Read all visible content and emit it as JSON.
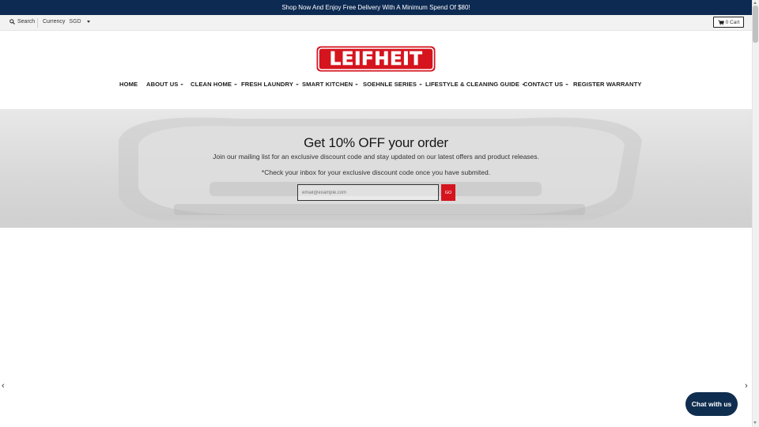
{
  "announcement": "Shop Now And Enjoy Free Delivery With A Minimum Spend Of $80!",
  "topbar": {
    "search_label": "Search",
    "currency_label": "Currency",
    "currency_value": "SGD",
    "cart_label": "0 Cart"
  },
  "logo": {
    "text": "LEIFHEIT"
  },
  "nav": {
    "items": [
      {
        "label": "HOME"
      },
      {
        "label": "ABOUT US"
      },
      {
        "label": "CLEAN HOME"
      },
      {
        "label": "FRESH LAUNDRY"
      },
      {
        "label": "SMART KITCHEN"
      },
      {
        "label": "SOEHNLE SERIES"
      },
      {
        "label": "LIFESTYLE & CLEANING GUIDE"
      },
      {
        "label": "CONTACT US"
      },
      {
        "label": "REGISTER WARRANTY"
      }
    ]
  },
  "promo": {
    "title": "Get 10% OFF your order",
    "subtitle": "Join our mailing list for an exclusive discount code and stay updated on our latest offers and product releases.",
    "note": "*Check your inbox for your exclusive discount code once you have submited.",
    "email_placeholder": "email@example.com",
    "button_label": "GO"
  },
  "slider": {
    "prev_icon": "chevron-left-icon",
    "next_icon": "chevron-right-icon"
  },
  "chat": {
    "label": "Chat with us"
  },
  "colors": {
    "announcement_bg": "#0d2a52",
    "brand_red": "#d5141e",
    "chat_bg": "#0f2d4f"
  }
}
